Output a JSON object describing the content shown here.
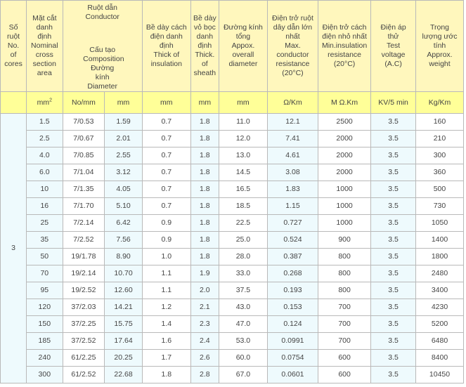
{
  "headers": {
    "cores": [
      "Số",
      "ruột",
      "No.",
      "of",
      "cores"
    ],
    "area": [
      "Mặt cắt",
      "danh",
      "định",
      "Nominal",
      "cross",
      "section",
      "area"
    ],
    "conductor_group": [
      "Ruột dẫn",
      "Conductor"
    ],
    "composition": [
      "Cấu tạo",
      "Composition"
    ],
    "diameter": [
      "Đường",
      "kính",
      "Diameter"
    ],
    "insulation": [
      "Bề dày cách",
      "điện danh",
      "định",
      "Thick of",
      "insulation"
    ],
    "sheath": [
      "Bề dày",
      "vỏ bọc",
      "danh",
      "định",
      "Thick.",
      "of",
      "sheath"
    ],
    "overall": [
      "Đường kính",
      "tổng",
      "Appox.",
      "overall",
      "diameter"
    ],
    "resistance": [
      "Điện trở ruột",
      "dây dẫn lớn",
      "nhất",
      "Max.",
      "conductor",
      "resistance",
      "(20°C)"
    ],
    "ins_resistance": [
      "Điện trở cách",
      "điện nhỏ nhất",
      "Min.insulation",
      "resistance",
      "(20°C)"
    ],
    "voltage": [
      "Điện áp",
      "thử",
      "Test",
      "voltage",
      "(A.C)"
    ],
    "weight": [
      "Trọng",
      "lượng ước",
      "tính",
      "Approx.",
      "weight"
    ]
  },
  "units": {
    "area_base": "mm",
    "area_sup": "2",
    "composition": "No/mm",
    "diameter": "mm",
    "insulation": "mm",
    "sheath": "mm",
    "overall": "mm",
    "resistance": "Ω/Km",
    "ins_resistance": "M Ω.Km",
    "voltage": "KV/5 min",
    "weight": "Kg/Km"
  },
  "cores_value": "3",
  "groups": [
    {
      "rows": [
        [
          "1.5",
          "7/0.53",
          "1.59",
          "0.7",
          "1.8",
          "11.0",
          "12.1",
          "2500",
          "3.5",
          "160"
        ],
        [
          "2.5",
          "7/0.67",
          "2.01",
          "0.7",
          "1.8",
          "12.0",
          "7.41",
          "2000",
          "3.5",
          "210"
        ],
        [
          "4.0",
          "7/0.85",
          "2.55",
          "0.7",
          "1.8",
          "13.0",
          "4.61",
          "2000",
          "3.5",
          "300"
        ],
        [
          "6.0",
          "7/1.04",
          "3.12",
          "0.7",
          "1.8",
          "14.5",
          "3.08",
          "2000",
          "3.5",
          "360"
        ],
        [
          "10",
          "7/1.35",
          "4.05",
          "0.7",
          "1.8",
          "16.5",
          "1.83",
          "1000",
          "3.5",
          "500"
        ]
      ]
    },
    {
      "rows": [
        [
          "16",
          "7/1.70",
          "5.10",
          "0.7",
          "1.8",
          "18.5",
          "1.15",
          "1000",
          "3.5",
          "730"
        ],
        [
          "25",
          "7/2.14",
          "6.42",
          "0.9",
          "1.8",
          "22.5",
          "0.727",
          "1000",
          "3.5",
          "1050"
        ],
        [
          "35",
          "7/2.52",
          "7.56",
          "0.9",
          "1.8",
          "25.0",
          "0.524",
          "900",
          "3.5",
          "1400"
        ],
        [
          "50",
          "19/1.78",
          "8.90",
          "1.0",
          "1.8",
          "28.0",
          "0.387",
          "800",
          "3.5",
          "1800"
        ],
        [
          "70",
          "19/2.14",
          "10.70",
          "1.1",
          "1.9",
          "33.0",
          "0.268",
          "800",
          "3.5",
          "2480"
        ]
      ]
    },
    {
      "rows": [
        [
          "95",
          "19/2.52",
          "12.60",
          "1.1",
          "2.0",
          "37.5",
          "0.193",
          "800",
          "3.5",
          "3400"
        ],
        [
          "120",
          "37/2.03",
          "14.21",
          "1.2",
          "2.1",
          "43.0",
          "0.153",
          "700",
          "3.5",
          "4230"
        ],
        [
          "150",
          "37/2.25",
          "15.75",
          "1.4",
          "2.3",
          "47.0",
          "0.124",
          "700",
          "3.5",
          "5200"
        ],
        [
          "185",
          "37/2.52",
          "17.64",
          "1.6",
          "2.4",
          "53.0",
          "0.0991",
          "700",
          "3.5",
          "6480"
        ],
        [
          "240",
          "61/2.25",
          "20.25",
          "1.7",
          "2.6",
          "60.0",
          "0.0754",
          "600",
          "3.5",
          "8400"
        ],
        [
          "300",
          "61/2.52",
          "22.68",
          "1.8",
          "2.8",
          "67.0",
          "0.0601",
          "600",
          "3.5",
          "10450"
        ]
      ]
    }
  ]
}
